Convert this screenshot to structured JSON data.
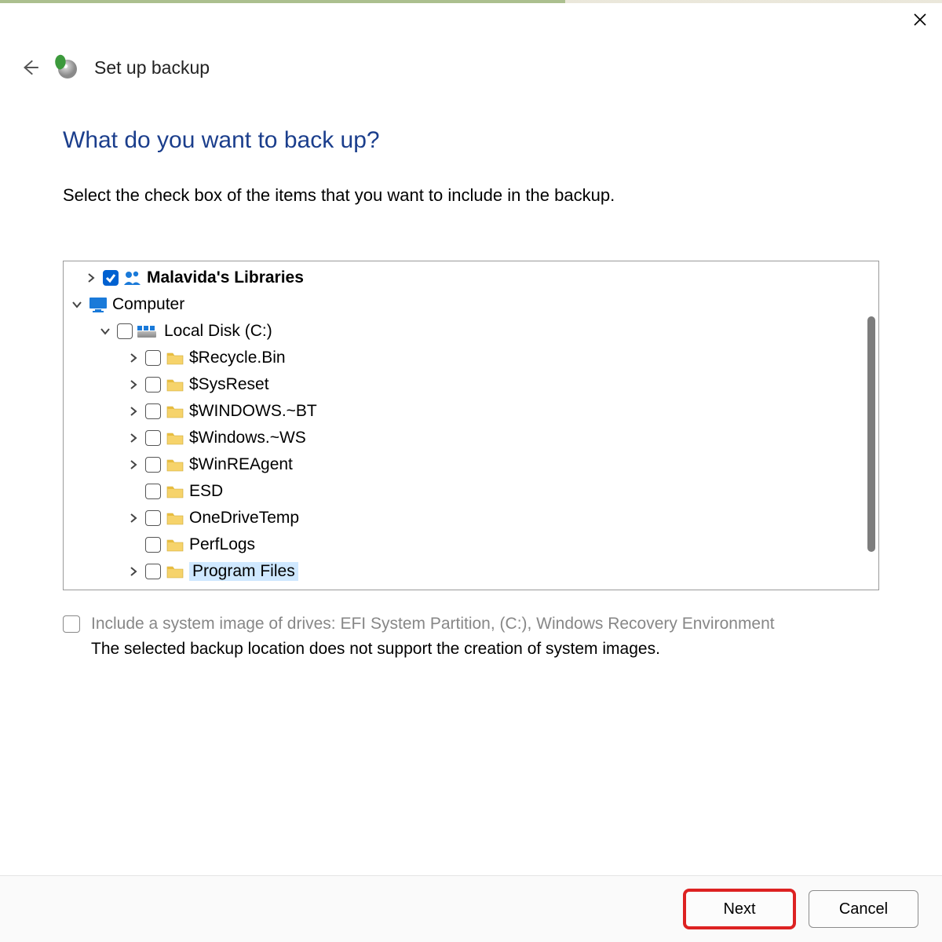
{
  "window": {
    "title": "Set up backup"
  },
  "heading": "What do you want to back up?",
  "instruction": "Select the check box of the items that you want to include in the backup.",
  "tree": {
    "libraries_label": "Malavida's Libraries",
    "computer_label": "Computer",
    "local_disk_label": "Local Disk (C:)",
    "items": [
      {
        "label": "$Recycle.Bin",
        "expandable": true
      },
      {
        "label": "$SysReset",
        "expandable": true
      },
      {
        "label": "$WINDOWS.~BT",
        "expandable": true
      },
      {
        "label": "$Windows.~WS",
        "expandable": true
      },
      {
        "label": "$WinREAgent",
        "expandable": true
      },
      {
        "label": "ESD",
        "expandable": false
      },
      {
        "label": "OneDriveTemp",
        "expandable": true
      },
      {
        "label": "PerfLogs",
        "expandable": false
      },
      {
        "label": "Program Files",
        "expandable": true,
        "selected": true
      }
    ]
  },
  "system_image": {
    "option_label": "Include a system image of drives: EFI System Partition, (C:), Windows Recovery Environment",
    "warning": "The selected backup location does not support the creation of system images."
  },
  "buttons": {
    "next": "Next",
    "cancel": "Cancel"
  }
}
